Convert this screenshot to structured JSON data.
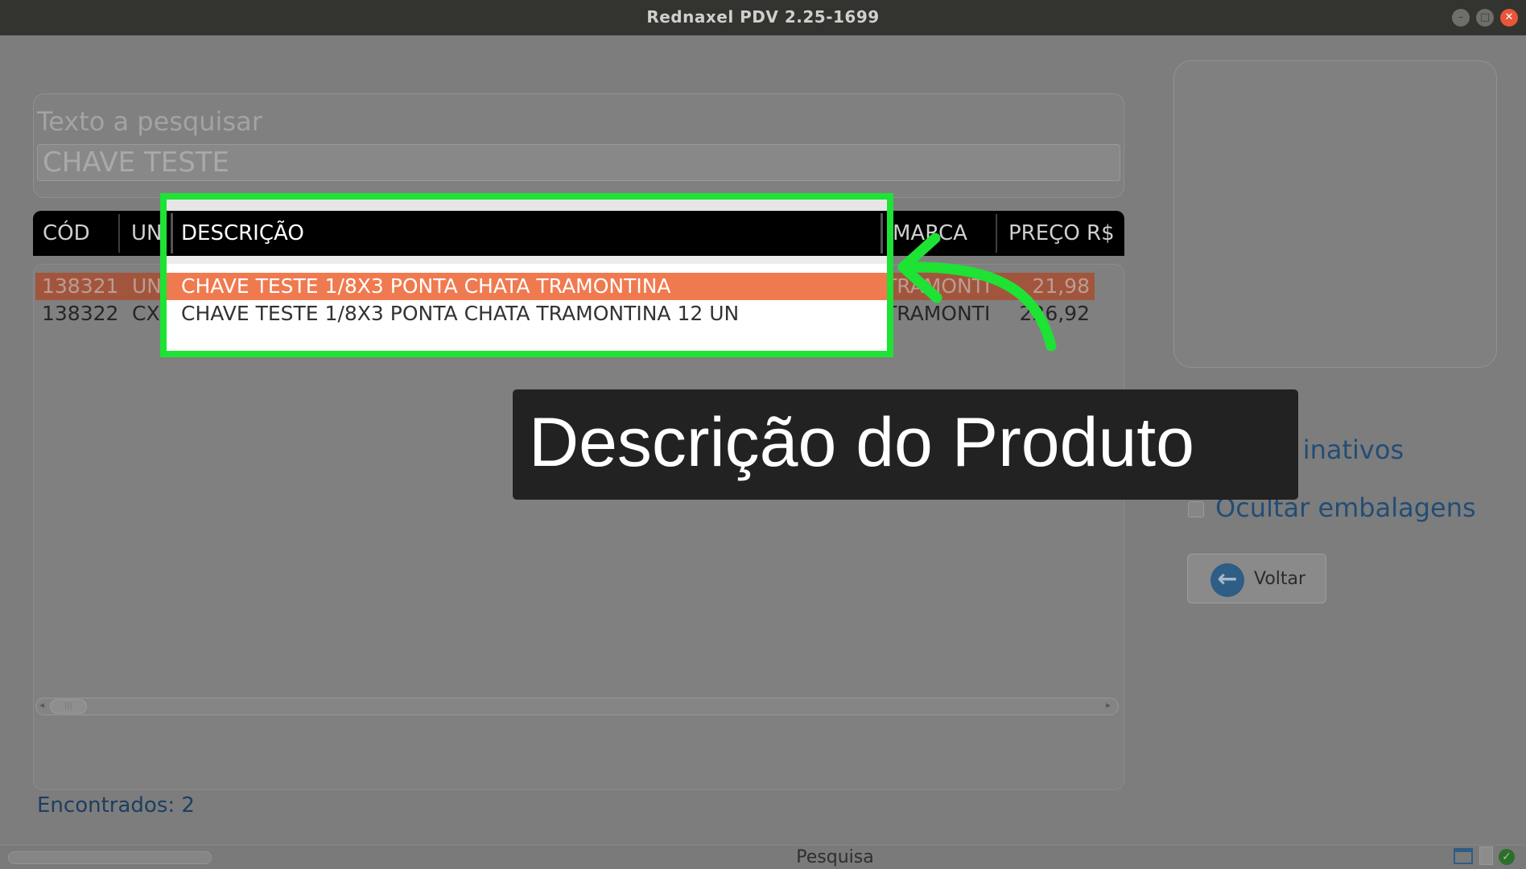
{
  "window": {
    "title": "Rednaxel PDV 2.25-1699"
  },
  "search": {
    "label": "Texto a pesquisar",
    "value": "CHAVE TESTE"
  },
  "table": {
    "columns": [
      "CÓD",
      "UN",
      "DESCRIÇÃO",
      "MARCA",
      "PREÇO R$"
    ],
    "rows": [
      {
        "cod": "138321",
        "un": "UN",
        "descricao": "CHAVE TESTE 1/8X3 PONTA CHATA TRAMONTINA",
        "marca": "TRAMONTI",
        "preco": "21,98"
      },
      {
        "cod": "138322",
        "un": "CX",
        "descricao": "CHAVE TESTE 1/8X3 PONTA CHATA TRAMONTINA 12 UN",
        "marca": "TRAMONTI",
        "preco": "226,92"
      }
    ]
  },
  "found": {
    "label": "Encontrados: 2"
  },
  "options": {
    "include_inactive": "Incluir inativos",
    "hide_packaging": "Ocultar embalagens"
  },
  "buttons": {
    "back": "Voltar"
  },
  "status": {
    "text": "Pesquisa"
  },
  "overlay": {
    "caption": "Descrição do Produto"
  },
  "colors": {
    "highlight": "#1ee234",
    "selected_row": "#f07a4f",
    "accent": "#2e5d86"
  },
  "icons": {
    "close": "close-icon",
    "back": "arrow-left-icon",
    "status_ok": "check-icon"
  }
}
